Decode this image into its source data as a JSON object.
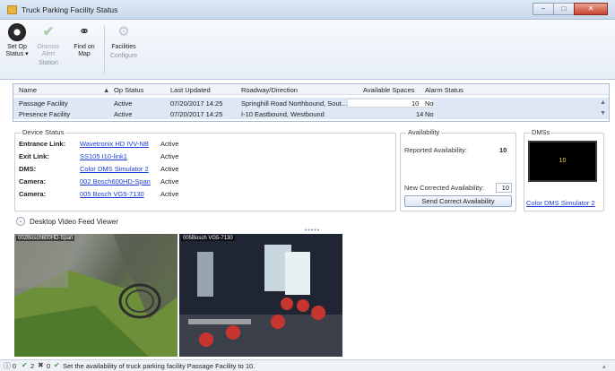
{
  "window": {
    "title": "Truck Parking Facility Status"
  },
  "ribbon": {
    "buttons": [
      {
        "label": "Set Op Status ▾",
        "icon": "op-status-icon",
        "enabled": true
      },
      {
        "label": "Dismiss Alert",
        "icon": "check-icon",
        "enabled": false
      },
      {
        "label": "Find on Map",
        "icon": "binoculars-icon",
        "enabled": true
      },
      {
        "label": "Facilities",
        "icon": "gear-icon",
        "enabled": false
      }
    ],
    "groups": {
      "station": "Station",
      "configure": "Configure"
    }
  },
  "grid": {
    "columns": [
      "Name",
      "Op Status",
      "Last Updated",
      "Roadway/Direction",
      "Available Spaces",
      "Alarm Status"
    ],
    "rows": [
      {
        "name": "Passage Facility",
        "op_status": "Active",
        "last_updated": "07/20/2017 14:25",
        "roadway": "Springhill Road Northbound, Sout...",
        "spaces": "10",
        "alarm": "No"
      },
      {
        "name": "Presence Facility",
        "op_status": "Active",
        "last_updated": "07/20/2017 14:25",
        "roadway": "I-10 Eastbound, Westbound",
        "spaces": "14",
        "alarm": "No"
      }
    ]
  },
  "device_status": {
    "title": "Device Status",
    "rows": [
      {
        "label": "Entrance Link:",
        "link": "Wavetronix HD IVV-NB",
        "status": "Active"
      },
      {
        "label": "Exit Link:",
        "link": "SS105 I10-link1",
        "status": "Active"
      },
      {
        "label": "DMS:",
        "link": "Color DMS Simulator 2",
        "status": "Active"
      },
      {
        "label": "Camera:",
        "link": "002 Bosch600HD-Span",
        "status": "Active"
      },
      {
        "label": "Camera:",
        "link": "005 Bosch VG5-7130",
        "status": "Active"
      }
    ]
  },
  "availability": {
    "title": "Availability",
    "reported_label": "Reported Availability:",
    "reported_value": "10",
    "corrected_label": "New Corrected Availability:",
    "corrected_value": "10",
    "send_button": "Send Correct Availability"
  },
  "dms": {
    "title": "DMSs",
    "screen_text": "10",
    "link": "Color DMS Simulator 2"
  },
  "video": {
    "title": "Desktop Video Feed Viewer",
    "grip": "•••••",
    "cameras": [
      {
        "label": "002Bosch600HD-Span"
      },
      {
        "label": "005Bosch VG5-7130"
      }
    ]
  },
  "statusbar": {
    "info_count": "0",
    "ok_count": "2",
    "error_count": "0",
    "message": "Set the availability of truck parking facility Passage Facility to 10."
  }
}
